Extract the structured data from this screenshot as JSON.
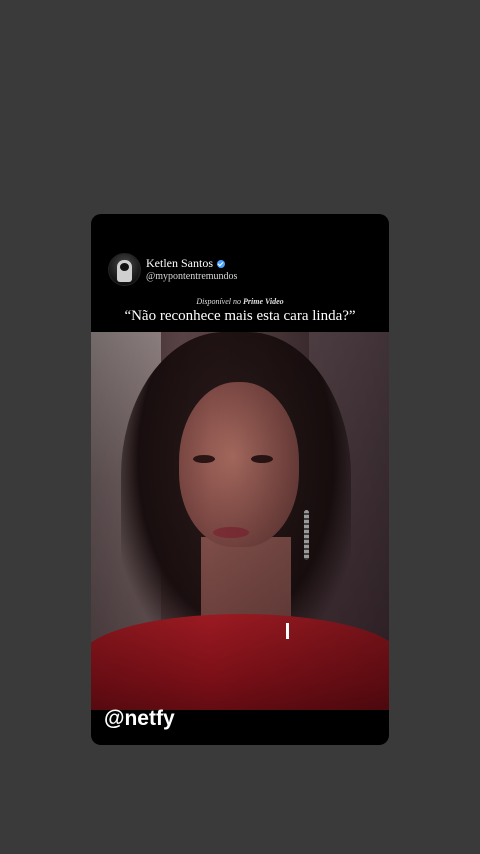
{
  "post": {
    "author_name": "Ketlen Santos",
    "author_handle": "@mypontentremundos",
    "verified_icon": "verified-badge-icon",
    "available_prefix": "Disponível no",
    "available_service": "Prime Video",
    "quote": "“Não reconhece mais esta cara linda?”",
    "watermark": "@netfy"
  },
  "colors": {
    "background": "#3a3a3a",
    "card": "#000000",
    "verified": "#4aa3ff"
  }
}
